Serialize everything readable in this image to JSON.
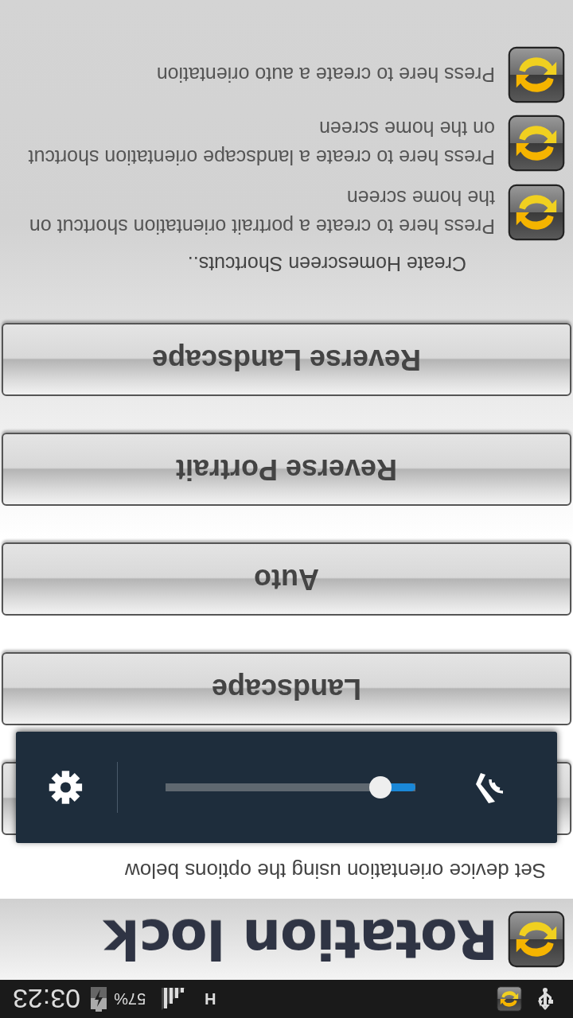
{
  "status_bar": {
    "network": "H",
    "battery": "57%",
    "time": "03:23"
  },
  "header": {
    "title": "Rotation lock"
  },
  "instruction": "Set device orientation using the options below",
  "brightness_popup": {
    "level": 0.14
  },
  "buttons": [
    {
      "label": "Landscape"
    },
    {
      "label": "Auto"
    },
    {
      "label": "Reverse Portrait"
    },
    {
      "label": "Reverse Landscape"
    }
  ],
  "shortcuts_heading": "Create Homescreen Shortcuts..",
  "shortcuts": [
    {
      "text": "Press here to create a portrait orientation shortcut on the home screen"
    },
    {
      "text": "Press here to create a landscape orientation shortcut on the home screen"
    },
    {
      "text": "Press here to create a auto orientation"
    }
  ]
}
